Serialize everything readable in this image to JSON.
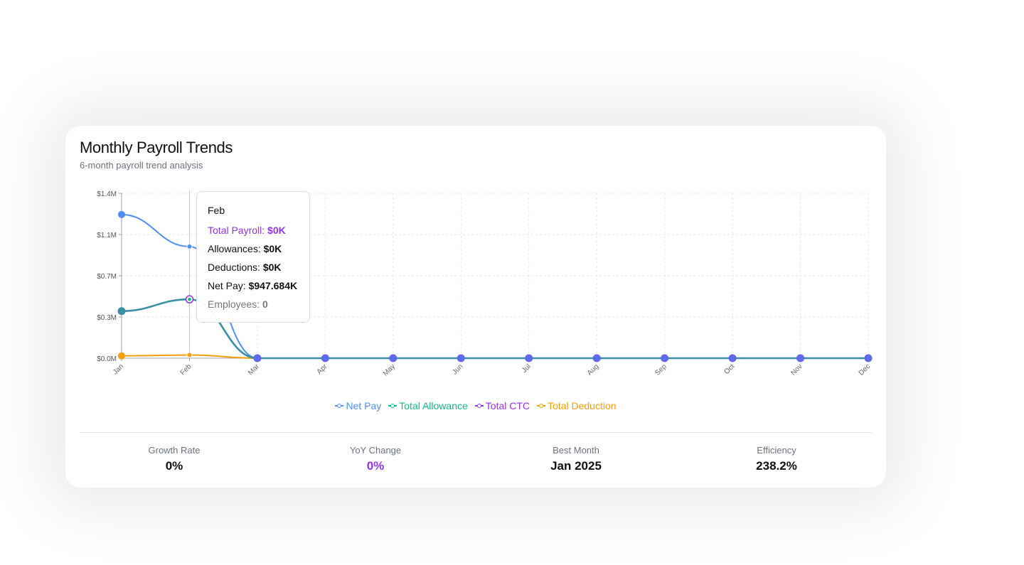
{
  "card": {
    "title": "Monthly Payroll Trends",
    "subtitle": "6-month payroll trend analysis"
  },
  "colors": {
    "net_pay": "#4f8ff5",
    "total_allowance": "#10b981",
    "total_ctc": "#9333ea",
    "total_deduction": "#f59e0b",
    "ctc_allowance_overlap": "#3a8fa3"
  },
  "chart_data": {
    "type": "line",
    "categories": [
      "Jan",
      "Feb",
      "Mar",
      "Apr",
      "May",
      "Jun",
      "Jul",
      "Aug",
      "Sep",
      "Oct",
      "Nov",
      "Dec"
    ],
    "y_ticks": [
      "$0.0M",
      "$0.3M",
      "$0.7M",
      "$1.1M",
      "$1.4M"
    ],
    "ylim": [
      0,
      1.4
    ],
    "grid": true,
    "legend_position": "bottom",
    "series": [
      {
        "name": "Net Pay",
        "color": "#4f8ff5",
        "values": [
          1.22,
          0.948,
          0,
          0,
          0,
          0,
          0,
          0,
          0,
          0,
          0,
          0
        ]
      },
      {
        "name": "Total Allowance",
        "color": "#10b981",
        "values": [
          0.4,
          0.5,
          0,
          0,
          0,
          0,
          0,
          0,
          0,
          0,
          0,
          0
        ]
      },
      {
        "name": "Total CTC",
        "color": "#9333ea",
        "values": [
          0.4,
          0.5,
          0,
          0,
          0,
          0,
          0,
          0,
          0,
          0,
          0,
          0
        ]
      },
      {
        "name": "Total Deduction",
        "color": "#f59e0b",
        "values": [
          0.02,
          0.027,
          0,
          0,
          0,
          0,
          0,
          0,
          0,
          0,
          0,
          0
        ]
      }
    ],
    "hover_category": "Feb"
  },
  "tooltip": {
    "title": "Feb",
    "rows": [
      {
        "label": "Total Payroll: ",
        "value": "$0K",
        "style": "purple"
      },
      {
        "label": "Allowances: ",
        "value": "$0K",
        "style": "dark"
      },
      {
        "label": "Deductions: ",
        "value": "$0K",
        "style": "dark"
      },
      {
        "label": "Net Pay: ",
        "value": "$947.684K",
        "style": "dark"
      },
      {
        "label": "Employees: ",
        "value": "0",
        "style": "gray"
      }
    ]
  },
  "legend": [
    {
      "label": "Net Pay",
      "color": "#4f8ff5"
    },
    {
      "label": "Total Allowance",
      "color": "#10b981"
    },
    {
      "label": "Total CTC",
      "color": "#9333ea"
    },
    {
      "label": "Total Deduction",
      "color": "#f59e0b"
    }
  ],
  "stats": [
    {
      "label": "Growth Rate",
      "value": "0%",
      "highlight": false
    },
    {
      "label": "YoY Change",
      "value": "0%",
      "highlight": true
    },
    {
      "label": "Best Month",
      "value": "Jan 2025",
      "highlight": false
    },
    {
      "label": "Efficiency",
      "value": "238.2%",
      "highlight": false
    }
  ]
}
